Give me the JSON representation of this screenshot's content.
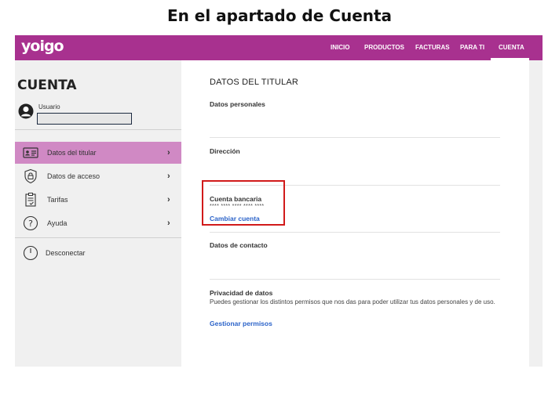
{
  "caption": "En el apartado de Cuenta",
  "brand": {
    "logo_text": "yoigo",
    "color": "#a8318f",
    "active_menu_color": "#d089c4",
    "link_color": "#2b63c9",
    "highlight_color": "#d11a1a"
  },
  "nav": {
    "items": [
      {
        "label": "INICIO"
      },
      {
        "label": "PRODUCTOS"
      },
      {
        "label": "FACTURAS"
      },
      {
        "label": "PARA TI"
      },
      {
        "label": "CUENTA"
      }
    ],
    "active": "CUENTA"
  },
  "sidebar": {
    "title": "CUENTA",
    "user_label": "Usuario",
    "user_value": "",
    "items": [
      {
        "label": "Datos del titular",
        "icon": "id-card-icon",
        "active": true
      },
      {
        "label": "Datos de acceso",
        "icon": "shield-lock-icon",
        "active": false
      },
      {
        "label": "Tarifas",
        "icon": "clipboard-icon",
        "active": false
      },
      {
        "label": "Ayuda",
        "icon": "help-circle-icon",
        "active": false
      }
    ],
    "logout_label": "Desconectar",
    "logout_icon": "power-icon"
  },
  "main": {
    "title": "DATOS DEL TITULAR",
    "sections": {
      "personal": {
        "heading": "Datos personales"
      },
      "address": {
        "heading": "Dirección"
      },
      "bank": {
        "heading": "Cuenta bancaria",
        "value": "**** **** **** **** ****",
        "action": "Cambiar cuenta"
      },
      "contact": {
        "heading": "Datos de contacto"
      },
      "privacy": {
        "heading": "Privacidad de datos",
        "description": "Puedes gestionar los distintos permisos que nos das para poder utilizar tus datos personales y de uso.",
        "action": "Gestionar permisos"
      }
    }
  }
}
